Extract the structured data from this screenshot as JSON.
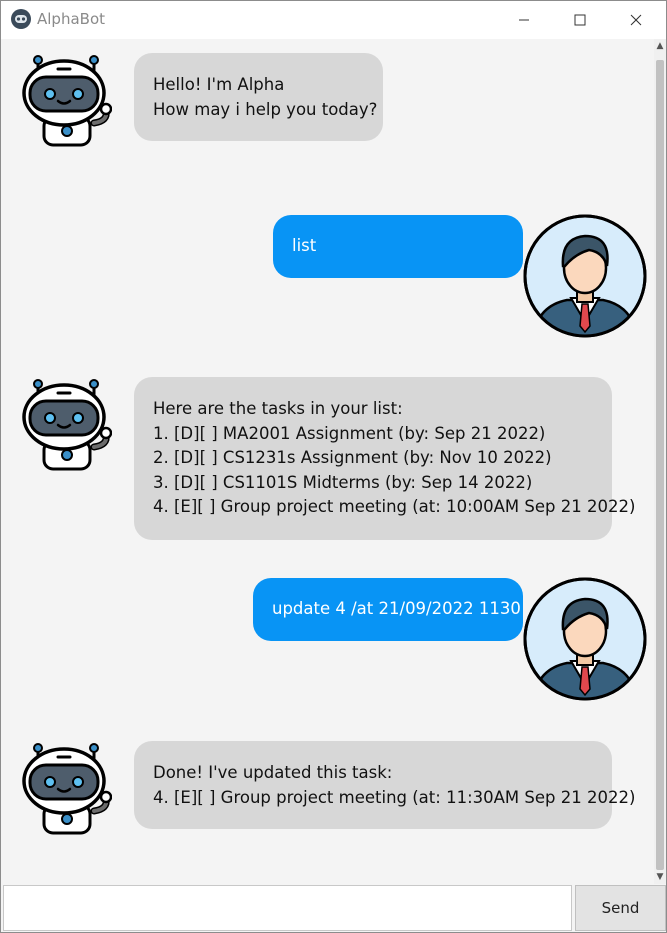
{
  "window": {
    "title": "AlphaBot"
  },
  "messages": [
    {
      "sender": "bot",
      "lines": [
        "Hello! I'm Alpha",
        "How may i help you today?"
      ]
    },
    {
      "sender": "user",
      "text": "list"
    },
    {
      "sender": "bot",
      "lines": [
        "Here are the tasks in your list:",
        "1. [D][ ] MA2001 Assignment (by: Sep 21 2022)",
        "2. [D][ ] CS1231s Assignment (by: Nov 10 2022)",
        "3. [D][ ] CS1101S Midterms (by: Sep 14 2022)",
        "4. [E][ ] Group project meeting (at: 10:00AM Sep 21 2022)"
      ]
    },
    {
      "sender": "user",
      "text": "update 4 /at 21/09/2022 1130"
    },
    {
      "sender": "bot",
      "lines": [
        "Done! I've updated this task:",
        "4. [E][ ] Group project meeting (at: 11:30AM Sep 21 2022)"
      ]
    }
  ],
  "input": {
    "value": "",
    "placeholder": ""
  },
  "send_label": "Send",
  "icons": {
    "bot": "robot-avatar-icon",
    "user": "businessman-avatar-icon",
    "app": "robot-app-icon"
  },
  "colors": {
    "user_bubble": "#0894f5",
    "bot_bubble": "#d7d7d7",
    "background": "#f4f4f4"
  }
}
